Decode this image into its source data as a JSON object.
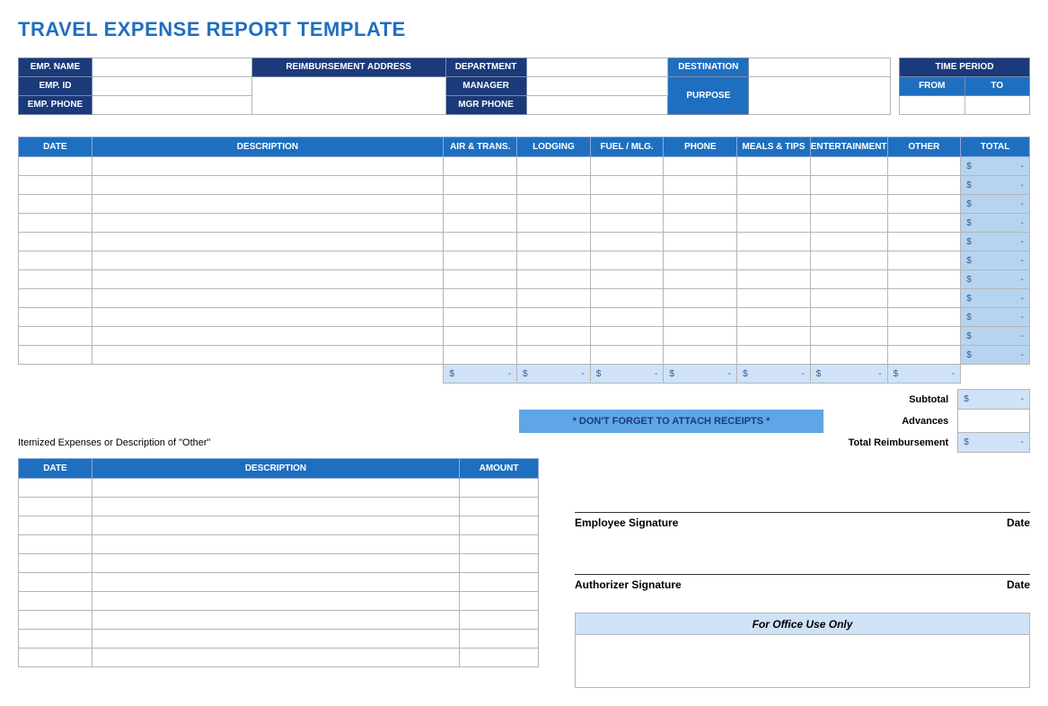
{
  "title": "TRAVEL EXPENSE REPORT TEMPLATE",
  "header": {
    "emp_name": "EMP. NAME",
    "emp_id": "EMP. ID",
    "emp_phone": "EMP. PHONE",
    "reimb_addr": "REIMBURSEMENT ADDRESS",
    "department": "DEPARTMENT",
    "manager": "MANAGER",
    "mgr_phone": "MGR PHONE",
    "destination": "DESTINATION",
    "purpose": "PURPOSE",
    "time_period": "TIME PERIOD",
    "from": "FROM",
    "to": "TO"
  },
  "expense_table": {
    "cols": {
      "date": "DATE",
      "description": "DESCRIPTION",
      "air": "AIR & TRANS.",
      "lodging": "LODGING",
      "fuel": "FUEL / MLG.",
      "phone": "PHONE",
      "meals": "MEALS & TIPS",
      "ent": "ENTERTAINMENT",
      "other": "OTHER",
      "total": "TOTAL"
    },
    "row_count": 11,
    "total_placeholder": {
      "dollar": "$",
      "dash": "-"
    }
  },
  "summary": {
    "subtotal": "Subtotal",
    "advances": "Advances",
    "total_reimb": "Total Reimbursement",
    "receipts_note": "* DON'T FORGET TO ATTACH RECEIPTS *"
  },
  "itemized": {
    "note": "Itemized Expenses or Description of \"Other\"",
    "cols": {
      "date": "DATE",
      "description": "DESCRIPTION",
      "amount": "AMOUNT"
    },
    "row_count": 10
  },
  "signatures": {
    "emp_sig": "Employee Signature",
    "auth_sig": "Authorizer Signature",
    "date": "Date",
    "office": "For Office Use Only"
  }
}
